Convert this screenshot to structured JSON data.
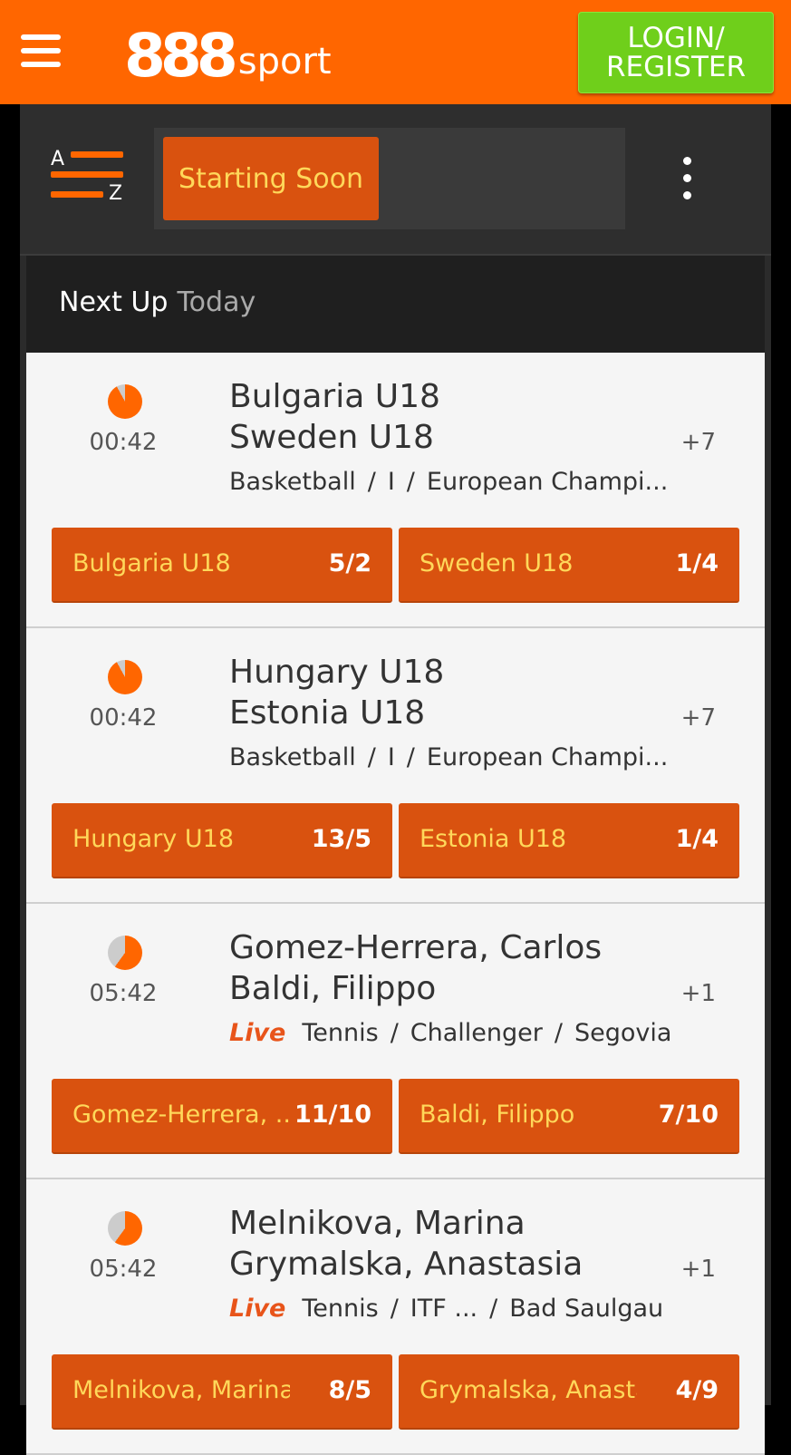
{
  "header": {
    "logo_number": "888",
    "logo_word": "sport",
    "login_label_1": "LOGIN/",
    "login_label_2": "REGISTER"
  },
  "toolbar": {
    "sort_letter_top": "A",
    "sort_letter_bottom": "Z",
    "filter_label": "Starting Soon"
  },
  "section": {
    "title": "Next Up",
    "subtitle": "Today"
  },
  "events": [
    {
      "time": "00:42",
      "clock_progress": 0.92,
      "team_a": "Bulgaria U18",
      "team_b": "Sweden U18",
      "more": "+7",
      "live": "",
      "sport": "Basketball",
      "region": "I",
      "competition": "European Champi...",
      "odds": [
        {
          "name": "Bulgaria U18",
          "price": "5/2"
        },
        {
          "name": "Sweden U18",
          "price": "1/4"
        }
      ]
    },
    {
      "time": "00:42",
      "clock_progress": 0.92,
      "team_a": "Hungary U18",
      "team_b": "Estonia U18",
      "more": "+7",
      "live": "",
      "sport": "Basketball",
      "region": "I",
      "competition": "European Champi...",
      "odds": [
        {
          "name": "Hungary U18",
          "price": "13/5"
        },
        {
          "name": "Estonia U18",
          "price": "1/4"
        }
      ]
    },
    {
      "time": "05:42",
      "clock_progress": 0.6,
      "team_a": "Gomez-Herrera, Carlos",
      "team_b": "Baldi, Filippo",
      "more": "+1",
      "live": "Live",
      "sport": "Tennis",
      "region": "Challenger",
      "competition": "Segovia",
      "odds": [
        {
          "name": "Gomez-Herrera, ...",
          "price": "11/10"
        },
        {
          "name": "Baldi, Filippo",
          "price": "7/10"
        }
      ]
    },
    {
      "time": "05:42",
      "clock_progress": 0.6,
      "team_a": "Melnikova, Marina",
      "team_b": "Grymalska, Anastasia",
      "more": "+1",
      "live": "Live",
      "sport": "Tennis",
      "region": "ITF ...",
      "competition": "Bad Saulgau",
      "odds": [
        {
          "name": "Melnikova, Marina",
          "price": "8/5"
        },
        {
          "name": "Grymalska, Anastasia",
          "price": "4/9"
        }
      ]
    }
  ],
  "colors": {
    "brand": "#ff6600",
    "odds_button": "#d9520f",
    "live": "#e8541a",
    "login": "#6fcf1b"
  }
}
